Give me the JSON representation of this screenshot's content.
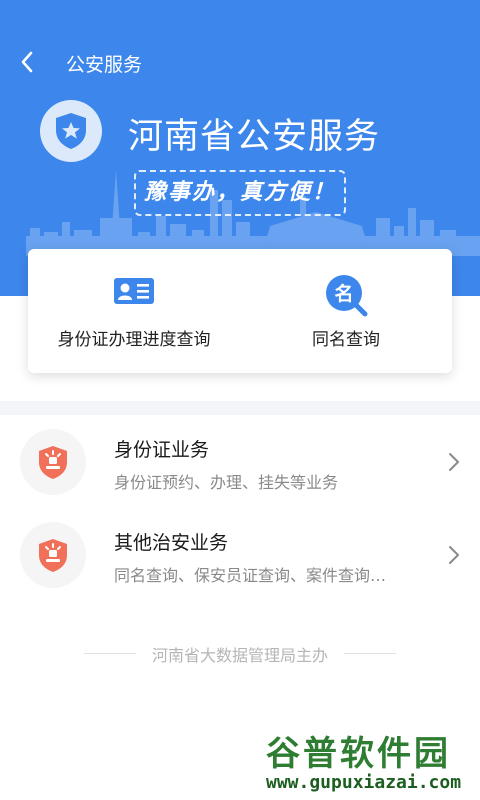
{
  "header": {
    "title": "公安服务",
    "brand_title": "河南省公安服务",
    "slogan": "豫事办，真方便！"
  },
  "quick_actions": [
    {
      "label": "身份证办理进度查询",
      "icon": "id-card-icon"
    },
    {
      "label": "同名查询",
      "icon": "name-search-icon"
    }
  ],
  "services": [
    {
      "title": "身份证业务",
      "subtitle": "身份证预约、办理、挂失等业务",
      "icon": "police-badge-icon"
    },
    {
      "title": "其他治安业务",
      "subtitle": "同名查询、保安员证查询、案件查询…",
      "icon": "police-badge-icon"
    }
  ],
  "footer": {
    "text": "河南省大数据管理局主办"
  },
  "watermark": {
    "top": "谷普软件园",
    "bottom": "www.gupuxiazai.com"
  },
  "colors": {
    "primary": "#3D87EC",
    "badge_red": "#F0705A",
    "text_secondary": "#8a8a8a"
  }
}
